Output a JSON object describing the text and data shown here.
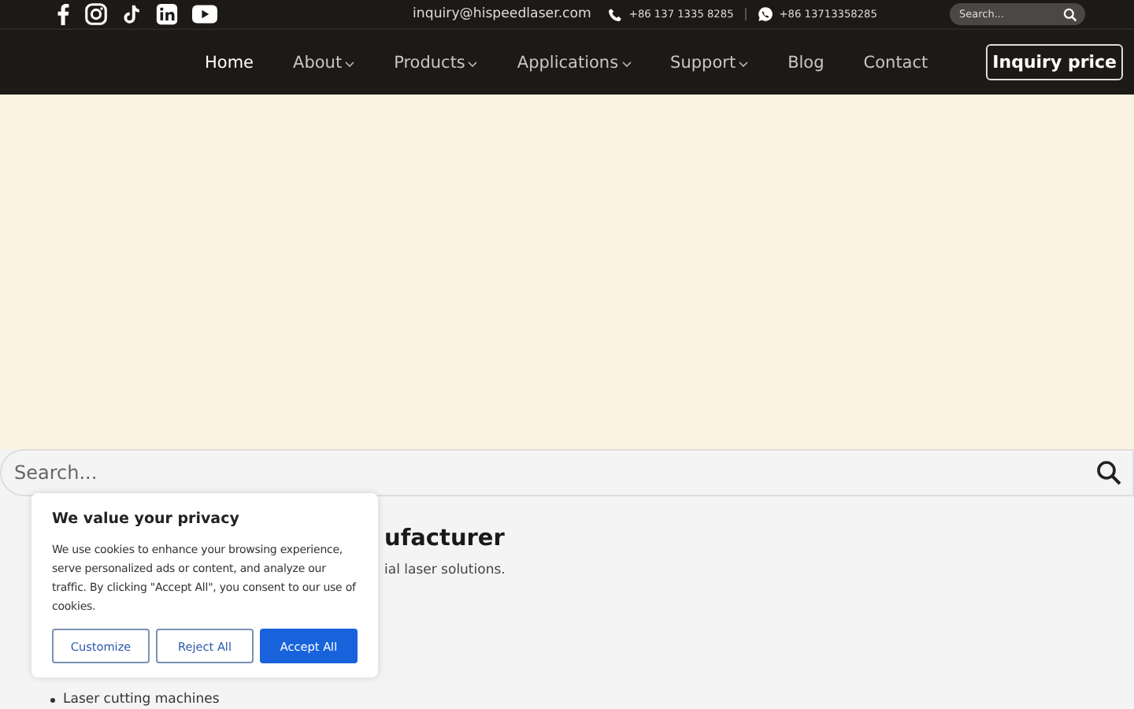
{
  "top_bar": {
    "email": "inquiry@hispeedlaser.com",
    "phones": [
      {
        "kind": "phone",
        "number": "+86 137 1335 8285"
      },
      {
        "kind": "chat",
        "number": "+86 13713358285"
      }
    ],
    "search": {
      "placeholder": "Search..."
    }
  },
  "nav": {
    "items": [
      {
        "label": "Home",
        "selected": true,
        "has_menu": false
      },
      {
        "label": "About",
        "selected": false,
        "has_menu": true
      },
      {
        "label": "Products",
        "selected": false,
        "has_menu": true
      },
      {
        "label": "Applications",
        "selected": false,
        "has_menu": true
      },
      {
        "label": "Support",
        "selected": false,
        "has_menu": true
      },
      {
        "label": "Blog",
        "selected": false,
        "has_menu": false
      },
      {
        "label": "Contact",
        "selected": false,
        "has_menu": false
      }
    ],
    "button": "Inquiry price"
  },
  "search_bar": {
    "placeholder": "Search..."
  },
  "content": {
    "heading": "ufacturer",
    "text": "ial laser solutions.",
    "list": [
      "Laser cutting machines"
    ]
  },
  "cookie_popup": {
    "title": "We value your privacy",
    "text": "We use cookies to enhance your browsing experience, serve personalized ads or content, and analyze our traffic. By clicking \"Accept All\", you consent to our use of cookies.",
    "buttons": [
      {
        "label": "Customize",
        "kind": "outline"
      },
      {
        "label": "Reject All",
        "kind": "outline"
      },
      {
        "label": "Accept All",
        "kind": "primary"
      }
    ]
  }
}
